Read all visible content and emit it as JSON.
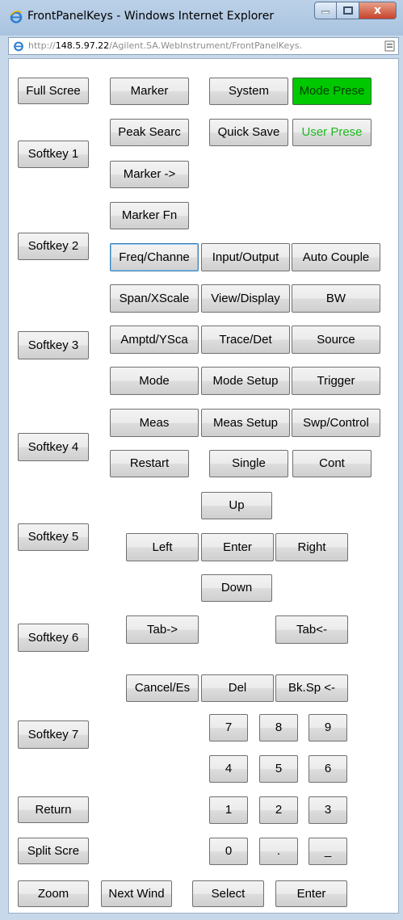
{
  "window": {
    "title": "FrontPanelKeys - Windows Internet Explorer",
    "close_glyph": "x",
    "address": {
      "prefix": "http://",
      "host": "148.5.97.22",
      "path": "/Agilent.SA.WebInstrument/FrontPanelKeys."
    }
  },
  "softkeys": [
    "Softkey 1",
    "Softkey 2",
    "Softkey 3",
    "Softkey 4",
    "Softkey 5",
    "Softkey 6",
    "Softkey 7"
  ],
  "left_controls": {
    "full_screen": "Full Scree",
    "return": "Return",
    "split_screen": "Split Scre",
    "zoom": "Zoom",
    "next_window": "Next Wind"
  },
  "keys": {
    "marker": "Marker",
    "system": "System",
    "mode_preset": "Mode Prese",
    "peak_search": "Peak Searc",
    "quick_save": "Quick Save",
    "user_preset": "User Prese",
    "marker_to": "Marker ->",
    "marker_fn": "Marker Fn",
    "freq_channel": "Freq/Channe",
    "input_output": "Input/Output",
    "auto_couple": "Auto Couple",
    "span_xscale": "Span/XScale",
    "view_display": "View/Display",
    "bw": "BW",
    "amptd_yscale": "Amptd/YSca",
    "trace_det": "Trace/Det",
    "source": "Source",
    "mode": "Mode",
    "mode_setup": "Mode Setup",
    "trigger": "Trigger",
    "meas": "Meas",
    "meas_setup": "Meas Setup",
    "swp_control": "Swp/Control",
    "restart": "Restart",
    "single": "Single",
    "cont": "Cont"
  },
  "navigation": {
    "up": "Up",
    "left": "Left",
    "enter": "Enter",
    "right": "Right",
    "down": "Down",
    "tab_forward": "Tab->",
    "tab_back": "Tab<-"
  },
  "edit": {
    "cancel_esc": "Cancel/Es",
    "del": "Del",
    "backspace": "Bk.Sp <-"
  },
  "numpad": [
    "7",
    "8",
    "9",
    "4",
    "5",
    "6",
    "1",
    "2",
    "3",
    "0",
    ".",
    "_"
  ],
  "bottom": {
    "select": "Select",
    "enter": "Enter"
  },
  "colors": {
    "mode_preset_bg": "#00c800",
    "user_preset_text": "#1fb81f",
    "focus_border": "#3c7fb1"
  }
}
